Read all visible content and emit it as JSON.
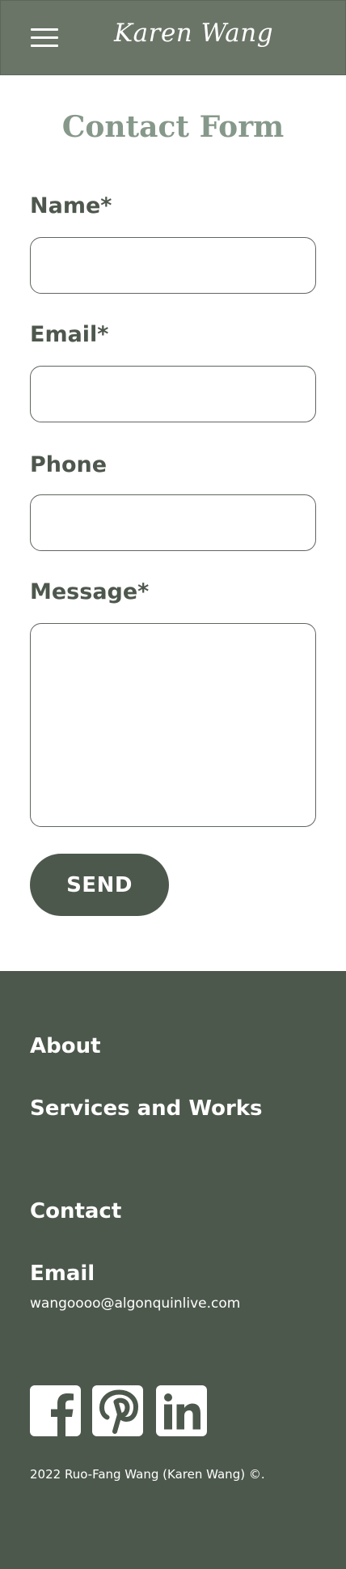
{
  "header": {
    "menu_icon": "hamburger-menu-icon",
    "logo_text": "Karen Wang"
  },
  "form": {
    "title": "Contact Form",
    "name_label": "Name*",
    "email_label": "Email*",
    "phone_label": "Phone",
    "message_label": "Message*",
    "name_value": "",
    "email_value": "",
    "phone_value": "",
    "message_value": "",
    "send_label": "SEND"
  },
  "footer": {
    "about": "About",
    "services": "Services and Works",
    "contact": "Contact",
    "email_heading": "Email",
    "email_address": "wangoooo@algonquinlive.com",
    "social": [
      "facebook-icon",
      "pinterest-icon",
      "linkedin-icon"
    ],
    "copyright": "2022 Ruo-Fang Wang (Karen Wang) ©."
  },
  "colors": {
    "header_bg": "#6a7567",
    "footer_bg": "#4d584c",
    "title": "#86988a",
    "label": "#4e574d"
  }
}
